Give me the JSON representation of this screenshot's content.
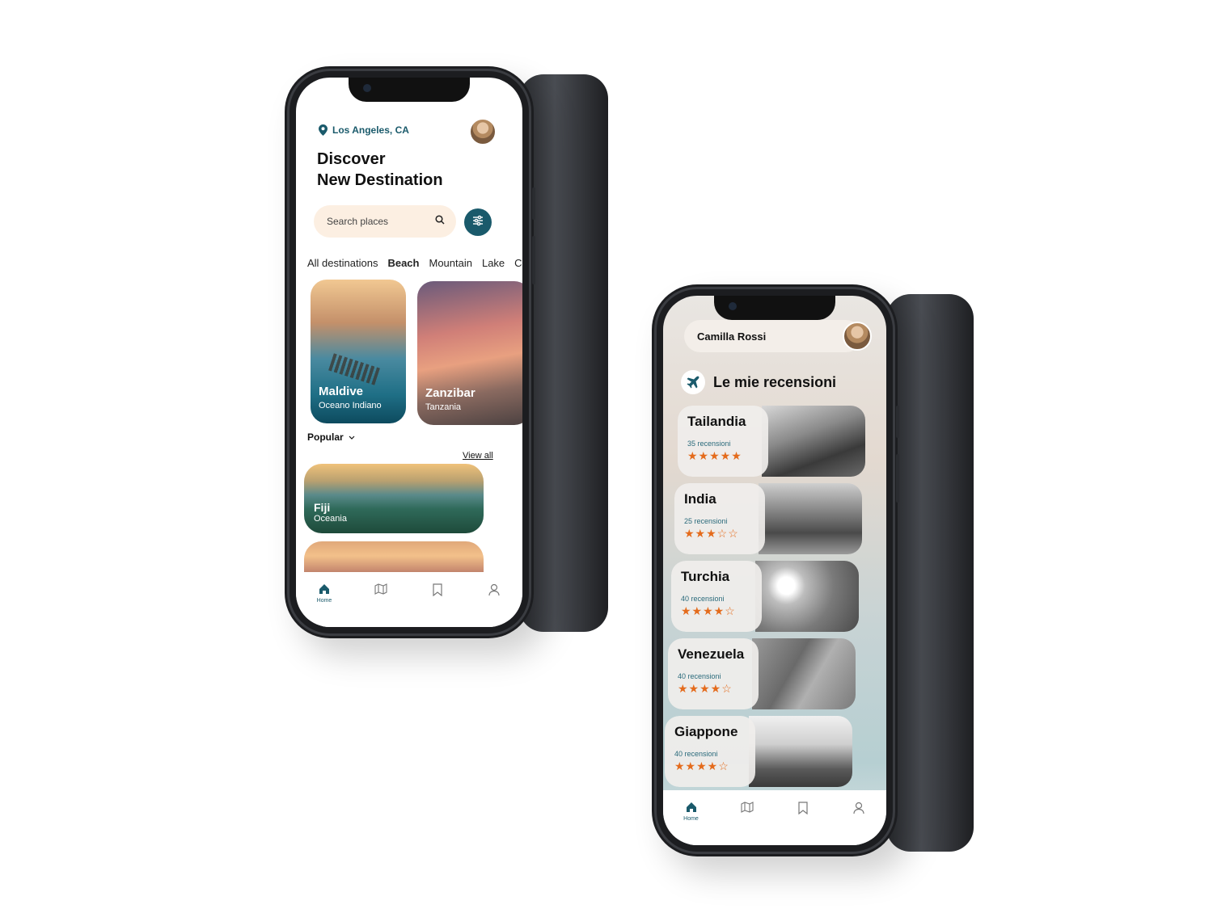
{
  "phone1": {
    "location": "Los Angeles, CA",
    "title_line1": "Discover",
    "title_line2": "New Destination",
    "search_placeholder": "Search places",
    "categories": [
      "All destinations",
      "Beach",
      "Mountain",
      "Lake",
      "City"
    ],
    "active_category": "Beach",
    "cards": [
      {
        "name": "Maldive",
        "sub": "Oceano Indiano"
      },
      {
        "name": "Zanzibar",
        "sub": "Tanzania"
      }
    ],
    "popular_label": "Popular",
    "view_all": "View all",
    "popular_cards": [
      {
        "name": "Fiji",
        "sub": "Oceania"
      }
    ],
    "nav": [
      "Home",
      "map-icon",
      "bookmark-icon",
      "profile-icon"
    ],
    "nav_home_label": "Home",
    "accent": "#1a5a6b"
  },
  "phone2": {
    "user_name": "Camilla Rossi",
    "section_title": "Le mie recensioni",
    "reviews": [
      {
        "country": "Tailandia",
        "count": "35 recensioni",
        "stars": "★★★★★"
      },
      {
        "country": "India",
        "count": "25 recensioni",
        "stars": "★★★☆☆"
      },
      {
        "country": "Turchia",
        "count": "40 recensioni",
        "stars": "★★★★☆"
      },
      {
        "country": "Venezuela",
        "count": "40 recensioni",
        "stars": "★★★★☆"
      },
      {
        "country": "Giappone",
        "count": "40 recensioni",
        "stars": "★★★★☆"
      }
    ],
    "nav_home_label": "Home",
    "star_color": "#e46b1c"
  }
}
